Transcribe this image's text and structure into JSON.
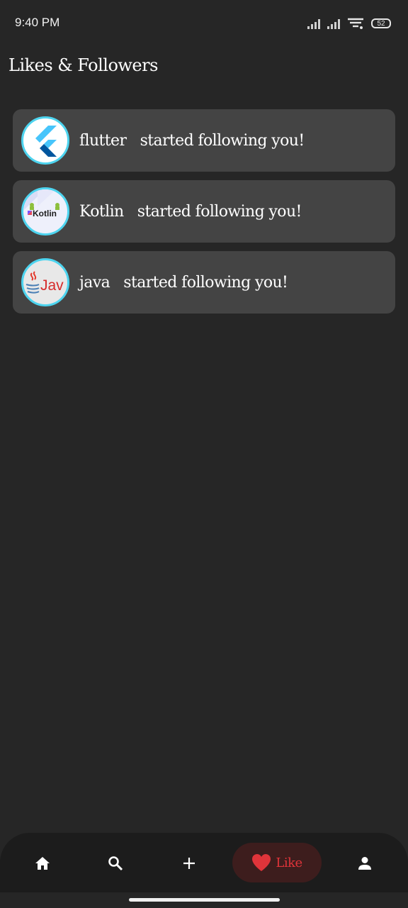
{
  "status_bar": {
    "time": "9:40 PM",
    "battery": "52"
  },
  "page_title": "Likes & Followers",
  "notifications": [
    {
      "name": "flutter",
      "message": "started following you!",
      "avatar_text": ""
    },
    {
      "name": "Kotlin",
      "message": "started following you!",
      "avatar_text": "Kotlin"
    },
    {
      "name": "java",
      "message": "started following you!",
      "avatar_text": "Jav"
    }
  ],
  "bottom_nav": {
    "items": [
      "home-icon",
      "search-icon",
      "plus-icon",
      "heart-icon",
      "person-icon"
    ],
    "active_label": "Like"
  },
  "colors": {
    "background": "#262626",
    "card": "#444444",
    "avatar_ring": "#4dd4ef",
    "like_accent": "#e0343a",
    "nav_bg": "#1c1c1c"
  }
}
